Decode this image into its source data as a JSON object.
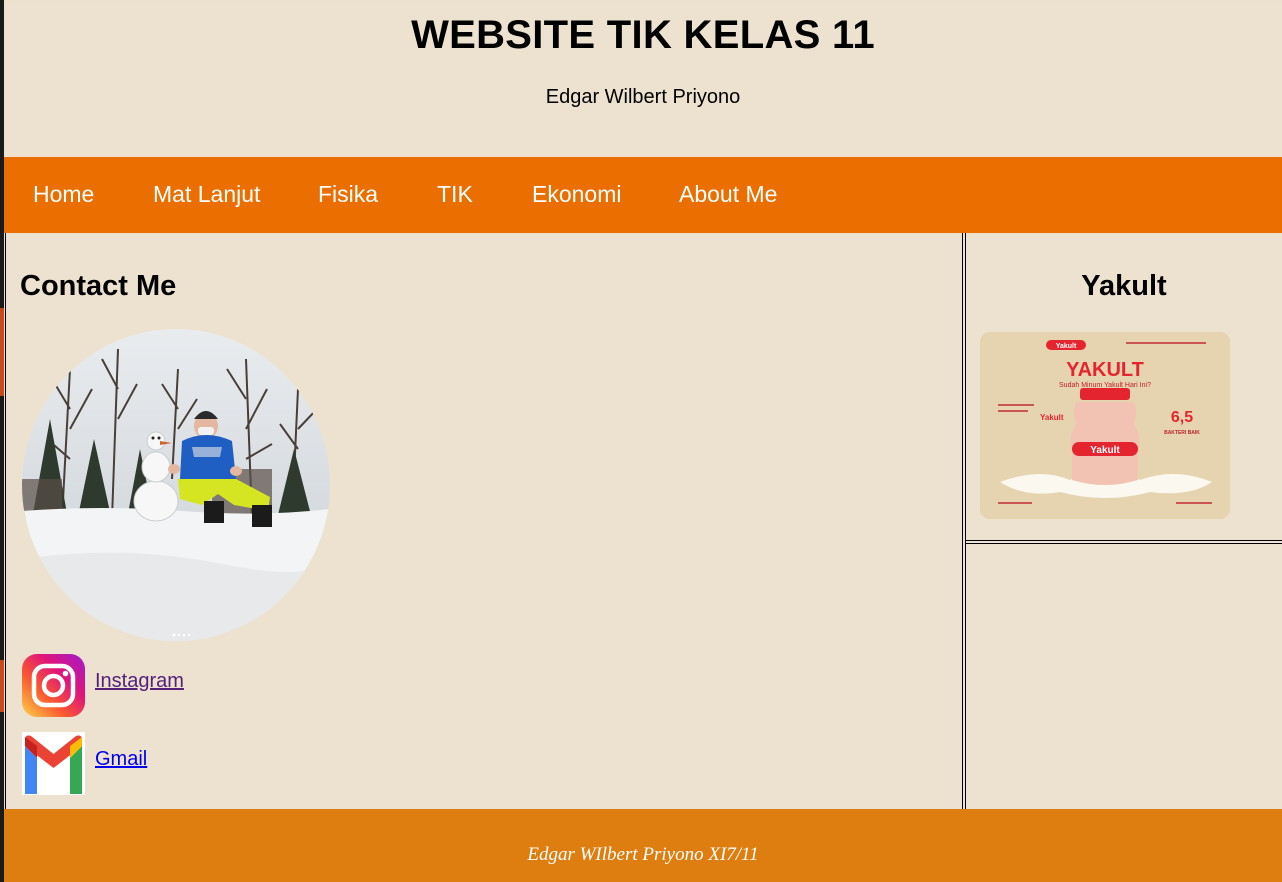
{
  "header": {
    "title": "WEBSITE TIK KELAS 11",
    "subtitle": "Edgar Wilbert Priyono"
  },
  "nav": {
    "items": [
      {
        "label": "Home"
      },
      {
        "label": "Mat Lanjut"
      },
      {
        "label": "Fisika"
      },
      {
        "label": "TIK"
      },
      {
        "label": "Ekonomi"
      },
      {
        "label": "About Me"
      }
    ]
  },
  "main": {
    "heading": "Contact Me",
    "photo_icon": "profile-photo",
    "links": [
      {
        "label": "Instagram",
        "icon": "instagram-icon"
      },
      {
        "label": "Gmail",
        "icon": "gmail-icon"
      }
    ]
  },
  "sidebar": {
    "heading": "Yakult",
    "ad": {
      "brand": "Yakult",
      "headline": "YAKULT",
      "tagline": "Sudah Minum Yakult Hari Ini?",
      "number": "6,5",
      "number_caption": "BAKTERI BAIK"
    }
  },
  "footer": {
    "text": "Edgar WIlbert Priyono XI7/11"
  },
  "colors": {
    "background": "#ece1cd",
    "nav": "#ea6f00",
    "footer": "#de7e10",
    "link_visited": "#55207a",
    "link": "#0000ee"
  }
}
